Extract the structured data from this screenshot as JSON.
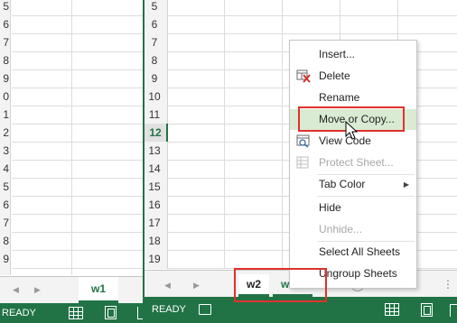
{
  "left_window": {
    "row_numbers": [
      "5",
      "6",
      "7",
      "8",
      "9",
      "0",
      "1",
      "2",
      "3",
      "4",
      "5",
      "6",
      "7",
      "8",
      "9"
    ],
    "sheet_tab": "w1",
    "status": "READY"
  },
  "right_window": {
    "row_numbers": [
      "5",
      "6",
      "7",
      "8",
      "9",
      "10",
      "11",
      "12",
      "13",
      "14",
      "15",
      "16",
      "17",
      "18",
      "19"
    ],
    "active_row": "12",
    "sheet_tabs": [
      "w2",
      "w2 2"
    ],
    "active_tab": "w2",
    "status": "READY"
  },
  "context_menu": {
    "items": [
      {
        "label": "Insert...",
        "icon": "insert"
      },
      {
        "label": "Delete",
        "icon": "delete-x-icon"
      },
      {
        "label": "Rename",
        "icon": ""
      },
      {
        "label": "Move or Copy...",
        "icon": "",
        "state": "hovered"
      },
      {
        "label": "View Code",
        "icon": "view-code-icon"
      },
      {
        "label": "Protect Sheet...",
        "icon": "protect-sheet-icon",
        "state": "disabled"
      },
      {
        "label": "Tab Color",
        "icon": "",
        "submenu": true
      },
      {
        "label": "Hide",
        "icon": ""
      },
      {
        "label": "Unhide...",
        "icon": "",
        "state": "disabled"
      },
      {
        "label": "Select All Sheets",
        "icon": ""
      },
      {
        "label": "Ungroup Sheets",
        "icon": ""
      }
    ]
  },
  "colors": {
    "excel_green": "#217346",
    "highlight_red": "#e0312c",
    "hover_green": "#d9ebd3"
  }
}
